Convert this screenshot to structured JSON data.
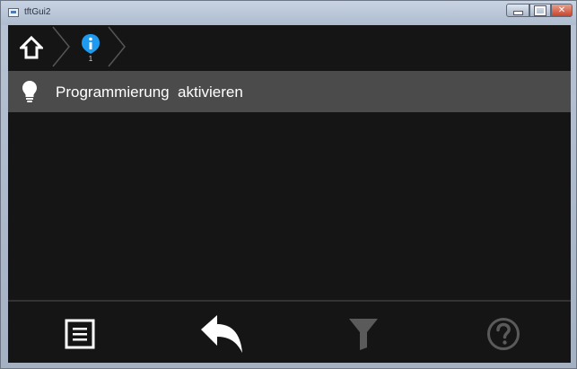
{
  "window": {
    "title": "tftGui2",
    "icons": [
      "app-icon",
      "minimize-icon",
      "maximize-icon",
      "close-icon"
    ]
  },
  "breadcrumb": {
    "items": [
      {
        "icon": "home-icon"
      },
      {
        "icon": "info-icon",
        "count": "1"
      }
    ]
  },
  "list": {
    "items": [
      {
        "icon": "lightbulb-icon",
        "label": "Programmierung  aktivieren"
      }
    ]
  },
  "toolbar": {
    "buttons": [
      {
        "icon": "menu-list-icon",
        "enabled": true
      },
      {
        "icon": "back-arrow-icon",
        "enabled": true
      },
      {
        "icon": "filter-icon",
        "enabled": false
      },
      {
        "icon": "help-icon",
        "enabled": false
      }
    ]
  },
  "colors": {
    "background": "#151515",
    "list_item": "#4b4b4b",
    "info_accent": "#1e9bf0",
    "disabled_icon": "#5a5a5a",
    "text": "#ffffff"
  }
}
